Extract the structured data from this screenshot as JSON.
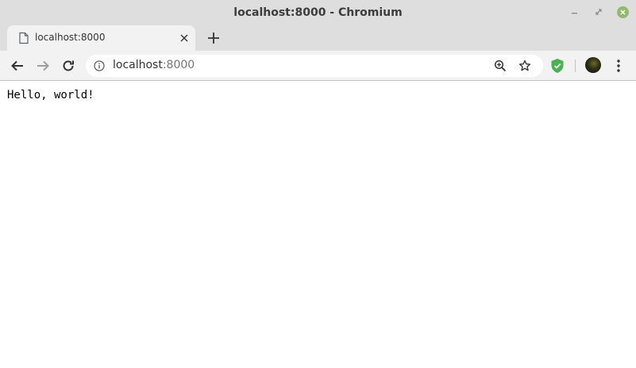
{
  "window": {
    "title": "localhost:8000 - Chromium"
  },
  "tabs": [
    {
      "title": "localhost:8000",
      "icon": "document-icon",
      "active": true
    }
  ],
  "toolbar": {
    "url_host": "localhost",
    "url_port": ":8000",
    "icons": [
      "back-arrow-icon",
      "forward-arrow-icon",
      "reload-icon",
      "info-icon",
      "zoom-icon",
      "star-icon",
      "shield-extension-icon",
      "profile-avatar",
      "menu-kebab-icon"
    ]
  },
  "page": {
    "body_text": "Hello, world!"
  },
  "colors": {
    "titlebar_bg": "#dedede",
    "toolbar_bg": "#f2f2f2",
    "close_button": "#8fba6f",
    "extension_shield": "#4caf50"
  }
}
